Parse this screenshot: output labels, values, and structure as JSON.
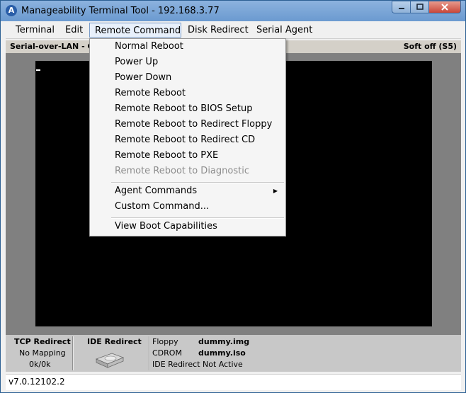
{
  "window": {
    "title": "Manageability Terminal Tool - 192.168.3.77",
    "app_icon": "A",
    "icons": {
      "minimize": "minimize-icon",
      "maximize": "maximize-icon",
      "close": "close-icon"
    }
  },
  "menubar": {
    "items": [
      {
        "label": "Terminal"
      },
      {
        "label": "Edit"
      },
      {
        "label": "Remote Command"
      },
      {
        "label": "Disk Redirect"
      },
      {
        "label": "Serial Agent"
      }
    ]
  },
  "status": {
    "left": "Serial-over-LAN - Co",
    "right": "Soft off (S5)"
  },
  "remote_command_menu": {
    "group1": [
      {
        "label": "Normal Reboot",
        "enabled": true
      },
      {
        "label": "Power Up",
        "enabled": true
      },
      {
        "label": "Power Down",
        "enabled": true
      },
      {
        "label": "Remote Reboot",
        "enabled": true
      },
      {
        "label": "Remote Reboot to BIOS Setup",
        "enabled": true
      },
      {
        "label": "Remote Reboot to Redirect Floppy",
        "enabled": true
      },
      {
        "label": "Remote Reboot to Redirect CD",
        "enabled": true
      },
      {
        "label": "Remote Reboot to PXE",
        "enabled": true
      },
      {
        "label": "Remote Reboot to Diagnostic",
        "enabled": false
      }
    ],
    "group2": [
      {
        "label": "Agent Commands",
        "submenu": true
      },
      {
        "label": "Custom Command...",
        "submenu": false
      }
    ],
    "group3": [
      {
        "label": "View Boot Capabilities"
      }
    ]
  },
  "bottom": {
    "tcp": {
      "title": "TCP Redirect",
      "mapping": "No Mapping",
      "rate": "0k/0k"
    },
    "ide": {
      "title": "IDE Redirect",
      "icon": "hard-drive-icon"
    },
    "disks": {
      "floppy_label": "Floppy",
      "floppy_value": "dummy.img",
      "cdrom_label": "CDROM",
      "cdrom_value": "dummy.iso",
      "ide_status": "IDE Redirect Not Active"
    }
  },
  "version": "v7.0.12102.2"
}
